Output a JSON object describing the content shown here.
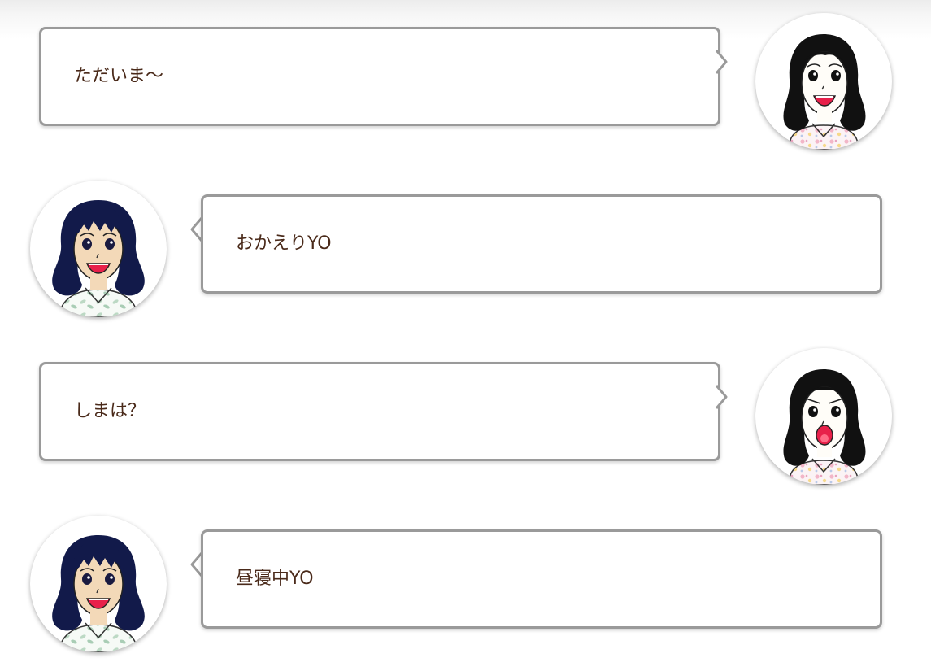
{
  "conversation": {
    "messages": [
      {
        "side": "right",
        "character": "long-black-hair-woman",
        "text": "ただいま〜"
      },
      {
        "side": "left",
        "character": "navy-bob-hair-woman",
        "text": "おかえりYO"
      },
      {
        "side": "right",
        "character": "long-black-hair-woman",
        "text": "しまは？"
      },
      {
        "side": "left",
        "character": "navy-bob-hair-woman",
        "text": "昼寝中YO"
      }
    ]
  },
  "colors": {
    "bubble_border": "#9a9a9a",
    "text": "#4a2a1a",
    "navy_hair": "#121a4a",
    "black_hair": "#111111",
    "mouth": "#e8204a"
  }
}
